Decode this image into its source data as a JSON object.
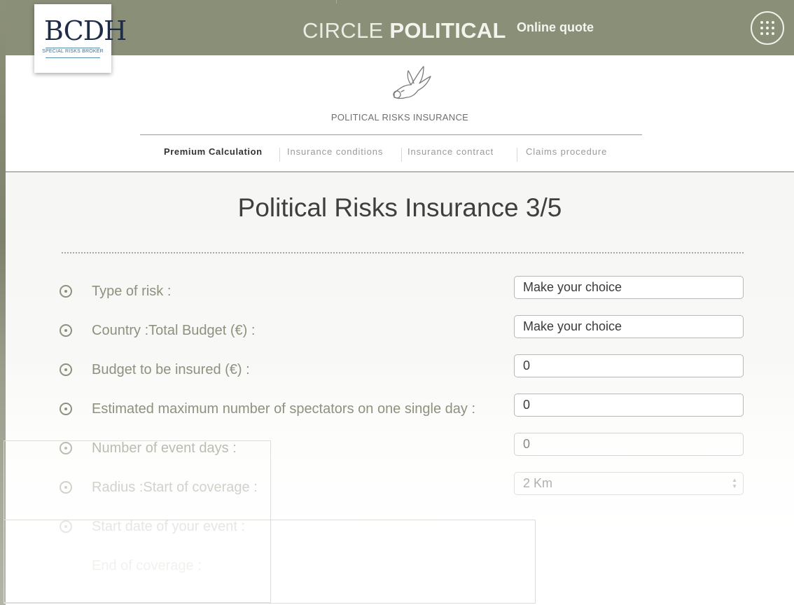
{
  "header": {
    "brand_light": "CIRCLE",
    "brand_bold": "POLITICAL",
    "online_quote": "Online quote"
  },
  "logo": {
    "mark": "BCDH",
    "subtitle": "SPECIAL RISKS BROKER"
  },
  "section": {
    "subtitle": "POLITICAL RISKS INSURANCE"
  },
  "subnav": [
    {
      "label": "Premium Calculation",
      "active": true
    },
    {
      "label": "Insurance conditions",
      "active": false
    },
    {
      "label": "Insurance contract",
      "active": false
    },
    {
      "label": "Claims procedure",
      "active": false
    }
  ],
  "form": {
    "title": "Political Risks Insurance 3/5",
    "fields": [
      {
        "label": "Type of risk :",
        "value": "Make your choice",
        "kind": "select"
      },
      {
        "label": "Country :Total Budget (€) :",
        "value": "Make your choice",
        "kind": "select"
      },
      {
        "label": "Budget to be insured (€) :",
        "value": "0",
        "kind": "input"
      },
      {
        "label": "Estimated maximum number of spectators on one single day :",
        "value": "0",
        "kind": "input"
      },
      {
        "label": "Number of event days :",
        "value": "0",
        "kind": "input"
      },
      {
        "label": "Radius :Start of coverage :",
        "value": "2 Km",
        "kind": "select"
      },
      {
        "label": "Start date of your event :",
        "value": "",
        "kind": "date"
      },
      {
        "label": "End of coverage :",
        "value": "",
        "kind": "date"
      }
    ]
  },
  "colors": {
    "header_bg": "#8a8f78",
    "label_color": "#8f917e",
    "active_tab": "#333333"
  }
}
